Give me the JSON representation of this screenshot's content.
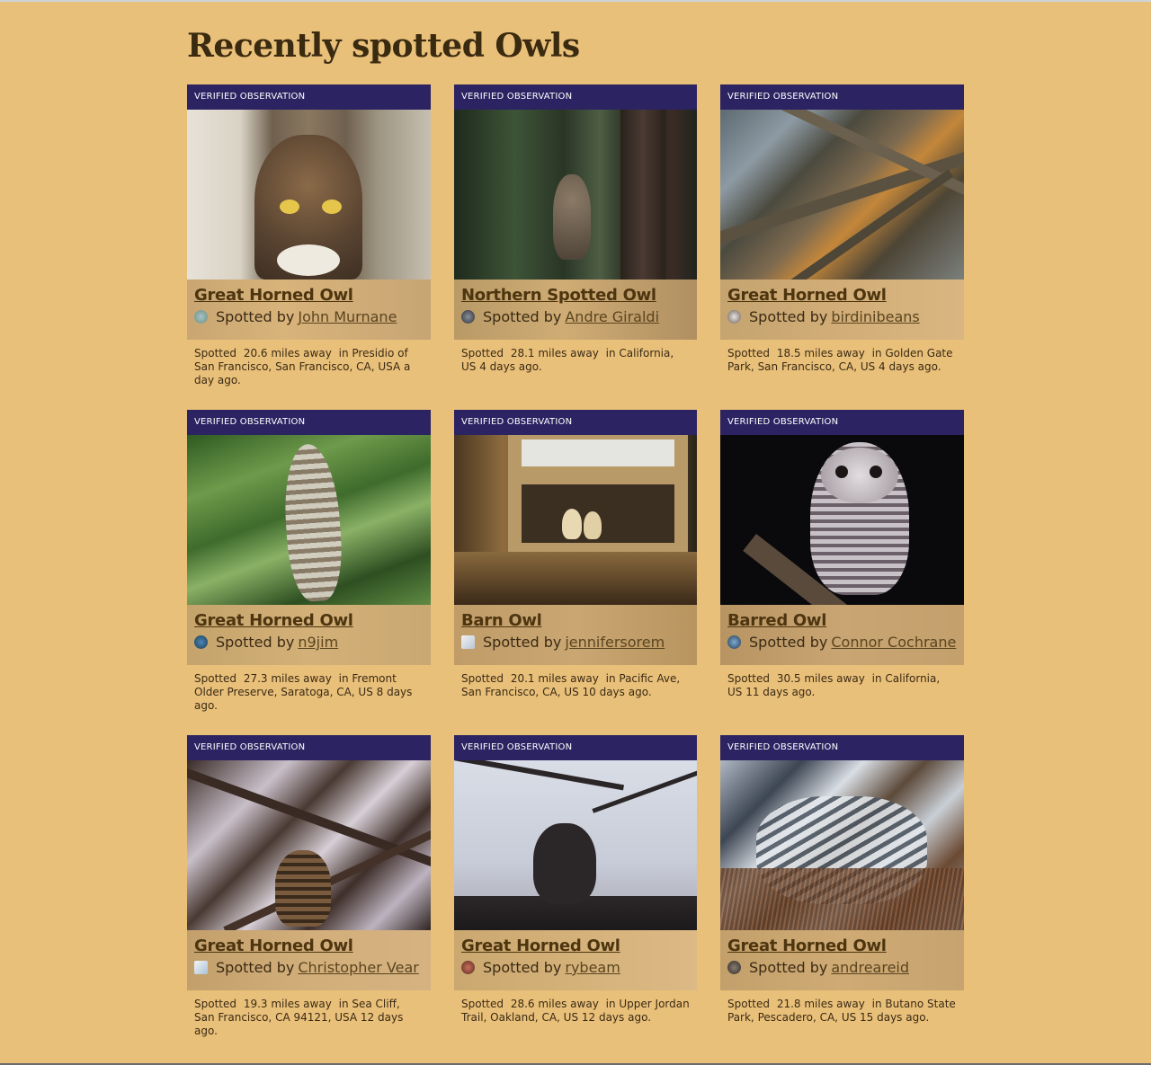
{
  "page": {
    "title": "Recently spotted Owls"
  },
  "colors": {
    "background": "#e9c07a",
    "badge": "#2b2362",
    "title_link": "#4d3510"
  },
  "cards": [
    {
      "badge": "VERIFIED OBSERVATION",
      "species": "Great Horned Owl",
      "spotted_by_prefix": "Spotted by",
      "user": "John Murnane",
      "spotted_prefix": "Spotted",
      "distance": "20.6 miles away",
      "location": "in Presidio of San Francisco, San Francisco, CA, USA a day ago."
    },
    {
      "badge": "VERIFIED OBSERVATION",
      "species": "Northern Spotted Owl",
      "spotted_by_prefix": "Spotted by",
      "user": "Andre Giraldi",
      "spotted_prefix": "Spotted",
      "distance": "28.1 miles away",
      "location": "in California, US 4 days ago."
    },
    {
      "badge": "VERIFIED OBSERVATION",
      "species": "Great Horned Owl",
      "spotted_by_prefix": "Spotted by",
      "user": "birdinibeans",
      "spotted_prefix": "Spotted",
      "distance": "18.5 miles away",
      "location": "in Golden Gate Park, San Francisco, CA, US 4 days ago."
    },
    {
      "badge": "VERIFIED OBSERVATION",
      "species": "Great Horned Owl",
      "spotted_by_prefix": "Spotted by",
      "user": "n9jim",
      "spotted_prefix": "Spotted",
      "distance": "27.3 miles away",
      "location": "in Fremont Older Preserve, Saratoga, CA, US 8 days ago."
    },
    {
      "badge": "VERIFIED OBSERVATION",
      "species": "Barn Owl",
      "spotted_by_prefix": "Spotted by",
      "user": "jennifersorem",
      "spotted_prefix": "Spotted",
      "distance": "20.1 miles away",
      "location": "in Pacific Ave, San Francisco, CA, US 10 days ago."
    },
    {
      "badge": "VERIFIED OBSERVATION",
      "species": "Barred Owl",
      "spotted_by_prefix": "Spotted by",
      "user": "Connor Cochrane",
      "spotted_prefix": "Spotted",
      "distance": "30.5 miles away",
      "location": "in California, US 11 days ago."
    },
    {
      "badge": "VERIFIED OBSERVATION",
      "species": "Great Horned Owl",
      "spotted_by_prefix": "Spotted by",
      "user": "Christopher Vear",
      "spotted_prefix": "Spotted",
      "distance": "19.3 miles away",
      "location": "in Sea Cliff, San Francisco, CA 94121, USA 12 days ago."
    },
    {
      "badge": "VERIFIED OBSERVATION",
      "species": "Great Horned Owl",
      "spotted_by_prefix": "Spotted by",
      "user": "rybeam",
      "spotted_prefix": "Spotted",
      "distance": "28.6 miles away",
      "location": "in Upper Jordan Trail, Oakland, CA, US 12 days ago."
    },
    {
      "badge": "VERIFIED OBSERVATION",
      "species": "Great Horned Owl",
      "spotted_by_prefix": "Spotted by",
      "user": "andreareid",
      "spotted_prefix": "Spotted",
      "distance": "21.8 miles away",
      "location": "in Butano State Park, Pescadero, CA, US 15 days ago."
    }
  ]
}
